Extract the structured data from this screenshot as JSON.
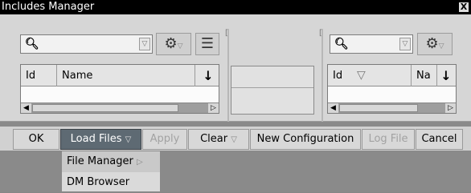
{
  "window": {
    "title": "Includes Manager",
    "close_label": "X"
  },
  "icons": {
    "search": "search-icon",
    "gear": "gear-icon",
    "list": "list-icon",
    "dropdown": "chevron-down-icon",
    "sort": "sort-down-arrow-icon",
    "filter": "filter-triangle-icon",
    "scroll_left": "scroll-left-icon",
    "scroll_right": "scroll-right-icon"
  },
  "left_panel": {
    "search": {
      "value": "",
      "placeholder": ""
    },
    "columns": [
      "Id",
      "Name"
    ]
  },
  "right_panel": {
    "search": {
      "value": "",
      "placeholder": ""
    },
    "columns": [
      "Id",
      "Na"
    ]
  },
  "buttons": {
    "ok": "OK",
    "load_files": "Load Files",
    "apply": "Apply",
    "clear": "Clear",
    "new_configuration": "New Configuration",
    "log_file": "Log File",
    "cancel": "Cancel"
  },
  "load_menu": {
    "items": [
      "File Manager",
      "DM Browser"
    ]
  },
  "colors": {
    "titlebar": "#000000",
    "active_button": "#5e6a73",
    "background": "#8a8a8a"
  }
}
